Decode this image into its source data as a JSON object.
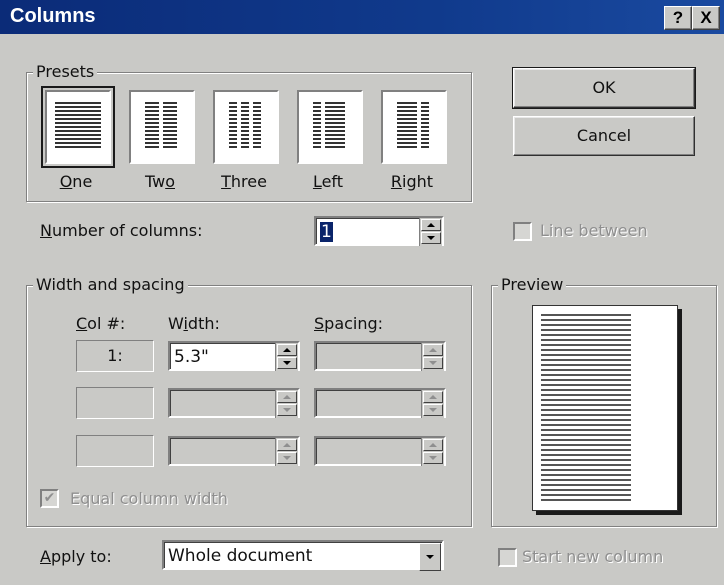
{
  "window": {
    "title": "Columns",
    "help_label": "?",
    "close_label": "X"
  },
  "presets": {
    "group_label": "Presets",
    "items": [
      {
        "key": "O",
        "rest": "ne"
      },
      {
        "pre": "Tw",
        "key": "o"
      },
      {
        "key": "T",
        "rest": "hree"
      },
      {
        "key": "L",
        "rest": "eft"
      },
      {
        "key": "R",
        "rest": "ight"
      }
    ],
    "selected": "One"
  },
  "buttons": {
    "ok": "OK",
    "cancel": "Cancel"
  },
  "number_of_columns": {
    "label_key": "N",
    "label_rest": "umber of columns:",
    "value": "1"
  },
  "line_between": {
    "label": "Line between",
    "checked": false
  },
  "width_spacing": {
    "group_label": "Width and spacing",
    "headers": {
      "col_key": "C",
      "col_rest": "ol #:",
      "width_pre": "W",
      "width_key": "i",
      "width_rest": "dth:",
      "spacing_key": "S",
      "spacing_rest": "pacing:"
    },
    "rows": [
      {
        "col": "1:",
        "width": "5.3\"",
        "spacing": ""
      },
      {
        "col": "",
        "width": "",
        "spacing": ""
      },
      {
        "col": "",
        "width": "",
        "spacing": ""
      }
    ],
    "equal_width": {
      "label": "Equal column width",
      "checked": true
    }
  },
  "preview": {
    "group_label": "Preview"
  },
  "apply_to": {
    "label_key": "A",
    "label_rest": "pply to:",
    "value": "Whole document"
  },
  "start_new_column": {
    "label": "Start new column",
    "checked": false
  }
}
